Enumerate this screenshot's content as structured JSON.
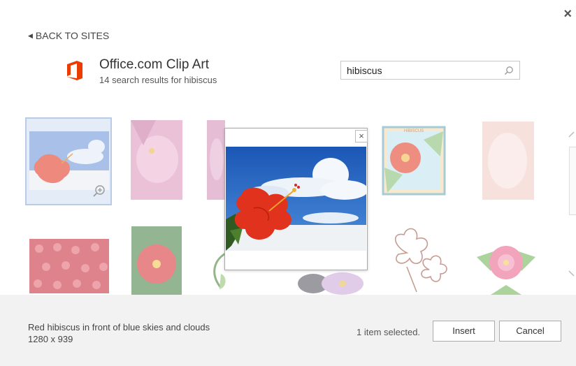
{
  "nav": {
    "back_label": "BACK TO SITES",
    "close_glyph": "×"
  },
  "site": {
    "title": "Office.com Clip Art",
    "subtitle": "14 search results for hibiscus",
    "logo_color": "#eb3c00"
  },
  "search": {
    "value": "hibiscus",
    "icon": "search-icon"
  },
  "results": [
    {
      "id": "r1",
      "selected": true
    },
    {
      "id": "r2"
    },
    {
      "id": "r3"
    },
    {
      "id": "r4"
    },
    {
      "id": "r5",
      "caption": "HIBISCUS"
    },
    {
      "id": "r6"
    },
    {
      "id": "r7"
    },
    {
      "id": "r8"
    },
    {
      "id": "r9"
    },
    {
      "id": "r10"
    },
    {
      "id": "r11"
    },
    {
      "id": "r12"
    }
  ],
  "preview": {
    "close_glyph": "×"
  },
  "footer": {
    "description": "Red hibiscus in front of blue skies and clouds",
    "dimensions": "1280 x 939",
    "selection_status": "1 item selected.",
    "insert_label": "Insert",
    "cancel_label": "Cancel"
  },
  "colors": {
    "accent_selection": "#b9cbe6",
    "footer_bg": "#f2f2f2",
    "sky": "#2f6fc9",
    "flower": "#e0321c"
  }
}
